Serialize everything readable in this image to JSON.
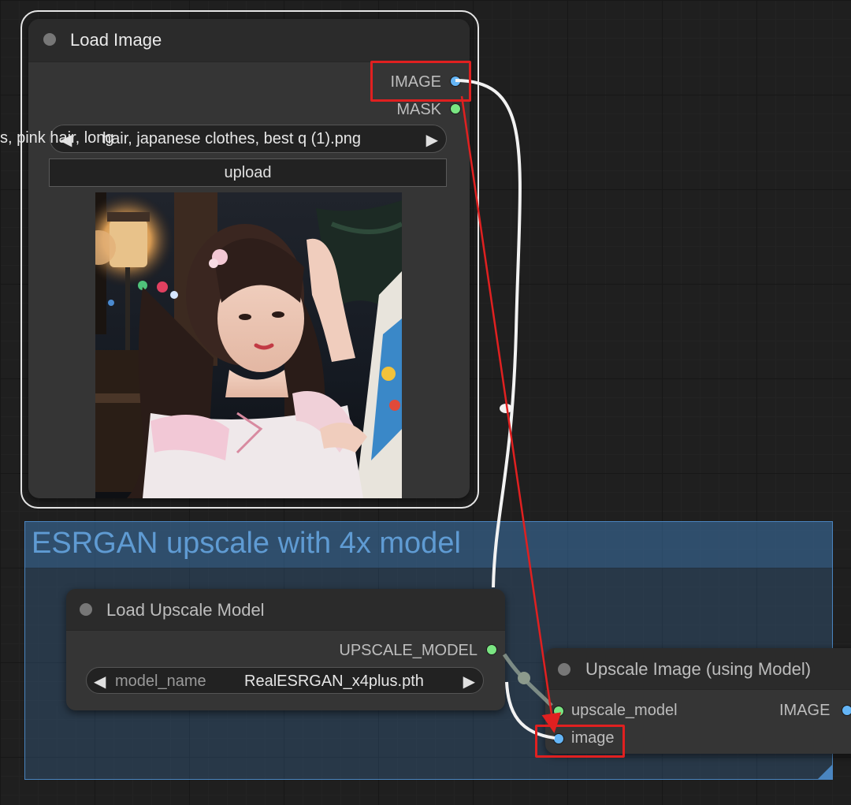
{
  "load_image": {
    "title": "Load Image",
    "outputs": {
      "image": "IMAGE",
      "mask": "MASK"
    },
    "filename_overflow": "s, pink hair, long",
    "filename": "hair, japanese clothes, best q (1).png",
    "upload_label": "upload",
    "preview_description": "anime-style girl with long dark hair painting at an easel under evening street lamps"
  },
  "group": {
    "title": "ESRGAN upscale with 4x model"
  },
  "load_upscale_model": {
    "title": "Load Upscale Model",
    "output": "UPSCALE_MODEL",
    "widget_name": "model_name",
    "widget_value": "RealESRGAN_x4plus.pth"
  },
  "upscale_image": {
    "title": "Upscale Image (using Model)",
    "inputs": {
      "upscale_model": "upscale_model",
      "image": "image"
    },
    "output": "IMAGE"
  },
  "icons": {
    "left": "◀",
    "right": "▶"
  },
  "colors": {
    "highlight": "#e02020",
    "image_slot": "#64b5f6",
    "mask_slot": "#7ae582",
    "group": "#3f7fbf"
  }
}
